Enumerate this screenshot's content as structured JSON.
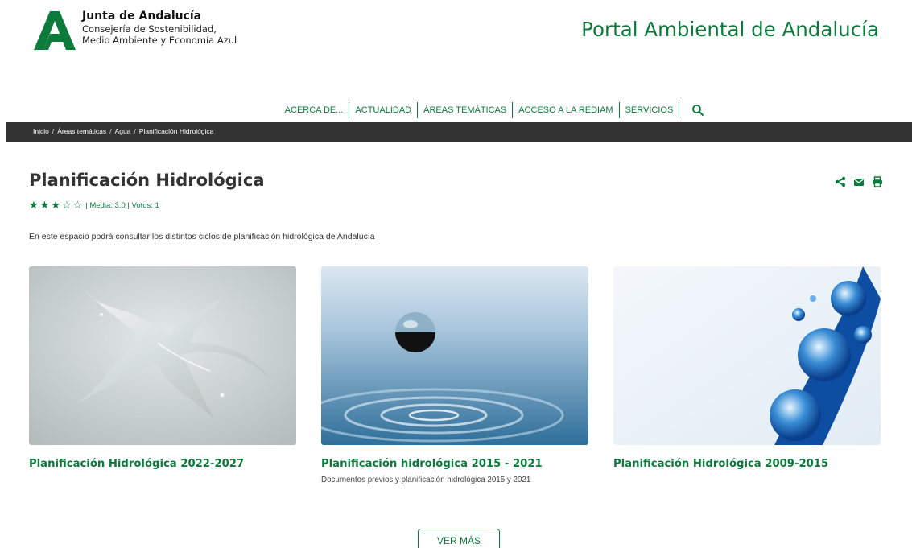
{
  "header": {
    "logo_title": "Junta de Andalucía",
    "logo_sub_1": "Consejería de Sostenibilidad,",
    "logo_sub_2": "Medio Ambiente y Economía Azul",
    "portal_title": "Portal Ambiental de Andalucía",
    "brand_color": "#0b7a3b"
  },
  "nav": {
    "items": [
      "ACERCA DE...",
      "ACTUALIDAD",
      "ÁREAS TEMÁTICAS",
      "ACCESO A LA REDIAM",
      "SERVICIOS"
    ],
    "search_icon": "search-icon"
  },
  "breadcrumb": {
    "items": [
      "Inicio",
      "Áreas temáticas",
      "Agua",
      "Planificación Hidrológica"
    ],
    "separator": "/"
  },
  "page": {
    "title": "Planificación Hidrológica",
    "rating": {
      "stars_filled": 3,
      "stars_total": 5,
      "text": "| Media: 3.0 | Votos: 1"
    },
    "tools": [
      "share-icon",
      "email-icon",
      "print-icon"
    ],
    "intro": "En este espacio podrá consultar los distintos ciclos de planificación hidrológica de Andalucía"
  },
  "cards": [
    {
      "title": "Planificación Hidrológica 2022-2027",
      "description": ""
    },
    {
      "title": "Planificación hidrológica 2015 - 2021",
      "description": "Documentos previos y planificación hidrológica 2015 y 2021"
    },
    {
      "title": "Planificación Hidrológica 2009-2015",
      "description": ""
    }
  ],
  "more_button": "VER MÁS"
}
